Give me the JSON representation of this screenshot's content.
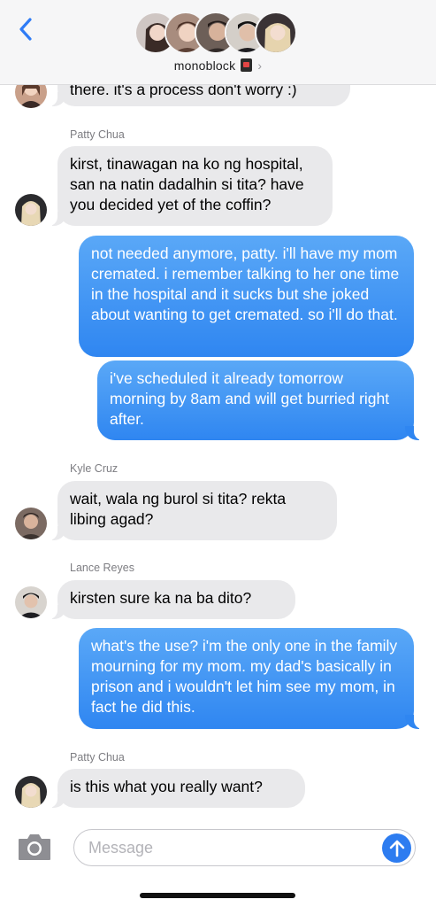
{
  "header": {
    "group_name": "monoblock",
    "members": [
      "member-1",
      "member-2",
      "member-3",
      "member-4",
      "member-5"
    ],
    "accent_color": "#2f7cf6"
  },
  "messages": [
    {
      "direction": "in",
      "sender": "",
      "text": "there. it's a process don't worry :)"
    },
    {
      "direction": "in",
      "sender": "Patty Chua",
      "text": "kirst, tinawagan na ko ng hospital, san na natin dadalhin si tita? have you decided yet of the coffin?"
    },
    {
      "direction": "out",
      "text": "not needed anymore, patty. i'll have my mom cremated. i remember talking to her one time in the hospital and it sucks but she joked about wanting to get cremated. so i'll do that."
    },
    {
      "direction": "out",
      "text": "i've scheduled it already tomorrow morning by 8am and will get burried right after."
    },
    {
      "direction": "in",
      "sender": "Kyle Cruz",
      "text": "wait, wala ng burol si tita? rekta libing agad?"
    },
    {
      "direction": "in",
      "sender": "Lance Reyes",
      "text": "kirsten sure ka na ba dito?"
    },
    {
      "direction": "out",
      "text": "what's the use? i'm the only one in the family mourning for my mom. my dad's basically in prison and i wouldn't let him see my mom, in fact he did this."
    },
    {
      "direction": "in",
      "sender": "Patty Chua",
      "text": "is this what you really want?"
    }
  ],
  "composer": {
    "placeholder": "Message"
  },
  "colors": {
    "incoming_bubble": "#e9e9eb",
    "outgoing_bubble": "#2f86f1",
    "send_button": "#2d7cf0"
  }
}
